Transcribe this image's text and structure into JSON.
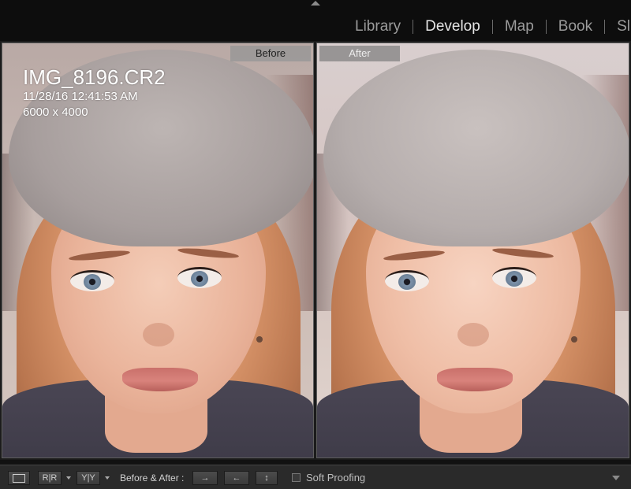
{
  "header": {
    "modules": [
      {
        "label": "Library",
        "active": false
      },
      {
        "label": "Develop",
        "active": true
      },
      {
        "label": "Map",
        "active": false
      },
      {
        "label": "Book",
        "active": false
      },
      {
        "label": "Sl",
        "active": false
      }
    ]
  },
  "viewer": {
    "before_label": "Before",
    "after_label": "After",
    "info": {
      "filename": "IMG_8196.CR2",
      "datetime": "11/28/16 12:41:53 AM",
      "dimensions": "6000 x 4000"
    }
  },
  "toolbar": {
    "view_modes": [
      {
        "name": "loupe-view-button",
        "text": ""
      },
      {
        "name": "before-after-rr-button",
        "text": "R|R"
      },
      {
        "name": "before-after-yy-button",
        "text": "Y|Y"
      }
    ],
    "before_after_label": "Before & After :",
    "copy_left_to_right": "→",
    "copy_right_to_left": "←",
    "swap_icon": "↕",
    "soft_proofing_label": "Soft Proofing",
    "soft_proofing_checked": false
  }
}
